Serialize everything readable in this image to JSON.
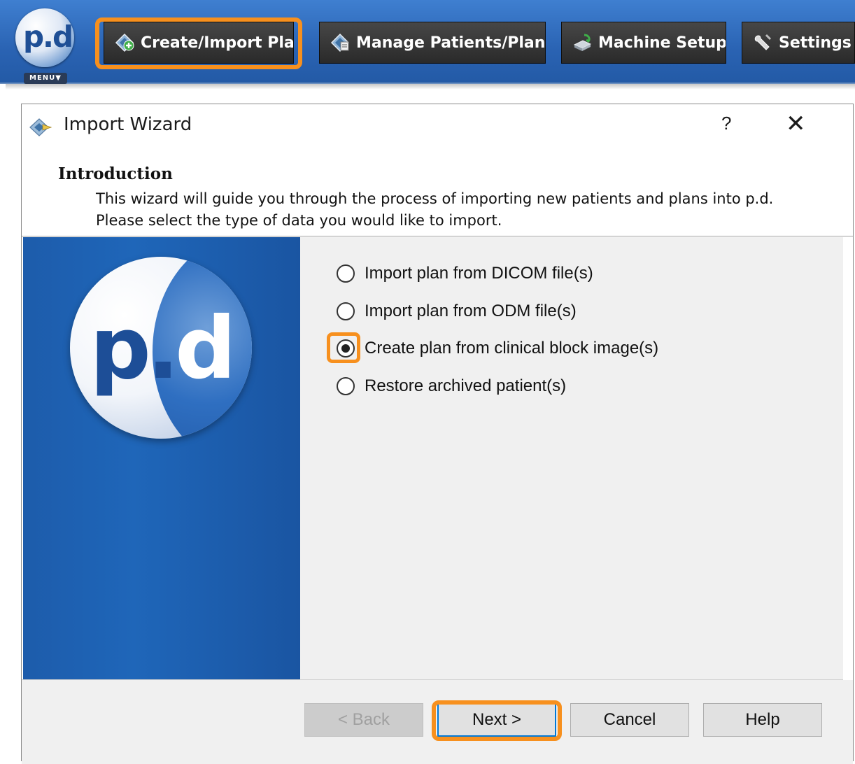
{
  "toolbar": {
    "logo_text": "p.d",
    "menu_label": "MENU▼",
    "buttons": [
      {
        "label": "Create/Import Plan",
        "icon": "create-import-icon"
      },
      {
        "label": "Manage Patients/Plans",
        "icon": "manage-patients-icon"
      },
      {
        "label": "Machine Setup",
        "icon": "machine-setup-icon"
      },
      {
        "label": "Settings",
        "icon": "settings-wrench-icon"
      }
    ]
  },
  "dialog": {
    "title": "Import Wizard",
    "help_glyph": "?",
    "close_glyph": "✕",
    "section_title": "Introduction",
    "description": "This wizard will guide you through the process of importing new patients and plans into p.d. Please select the type of data you would like to import.",
    "side_logo_p": "p.",
    "side_logo_d": "d",
    "options": [
      {
        "label": "Import plan from DICOM file(s)",
        "checked": false
      },
      {
        "label": "Import plan from ODM file(s)",
        "checked": false
      },
      {
        "label": "Create plan from clinical block image(s)",
        "checked": true
      },
      {
        "label": "Restore archived patient(s)",
        "checked": false
      }
    ],
    "footer_buttons": {
      "back": "< Back",
      "next": "Next >",
      "cancel": "Cancel",
      "help": "Help"
    }
  },
  "colors": {
    "toolbar_blue": "#2a63b3",
    "highlight_orange": "#f7901e",
    "side_panel_blue": "#1f66b9"
  }
}
